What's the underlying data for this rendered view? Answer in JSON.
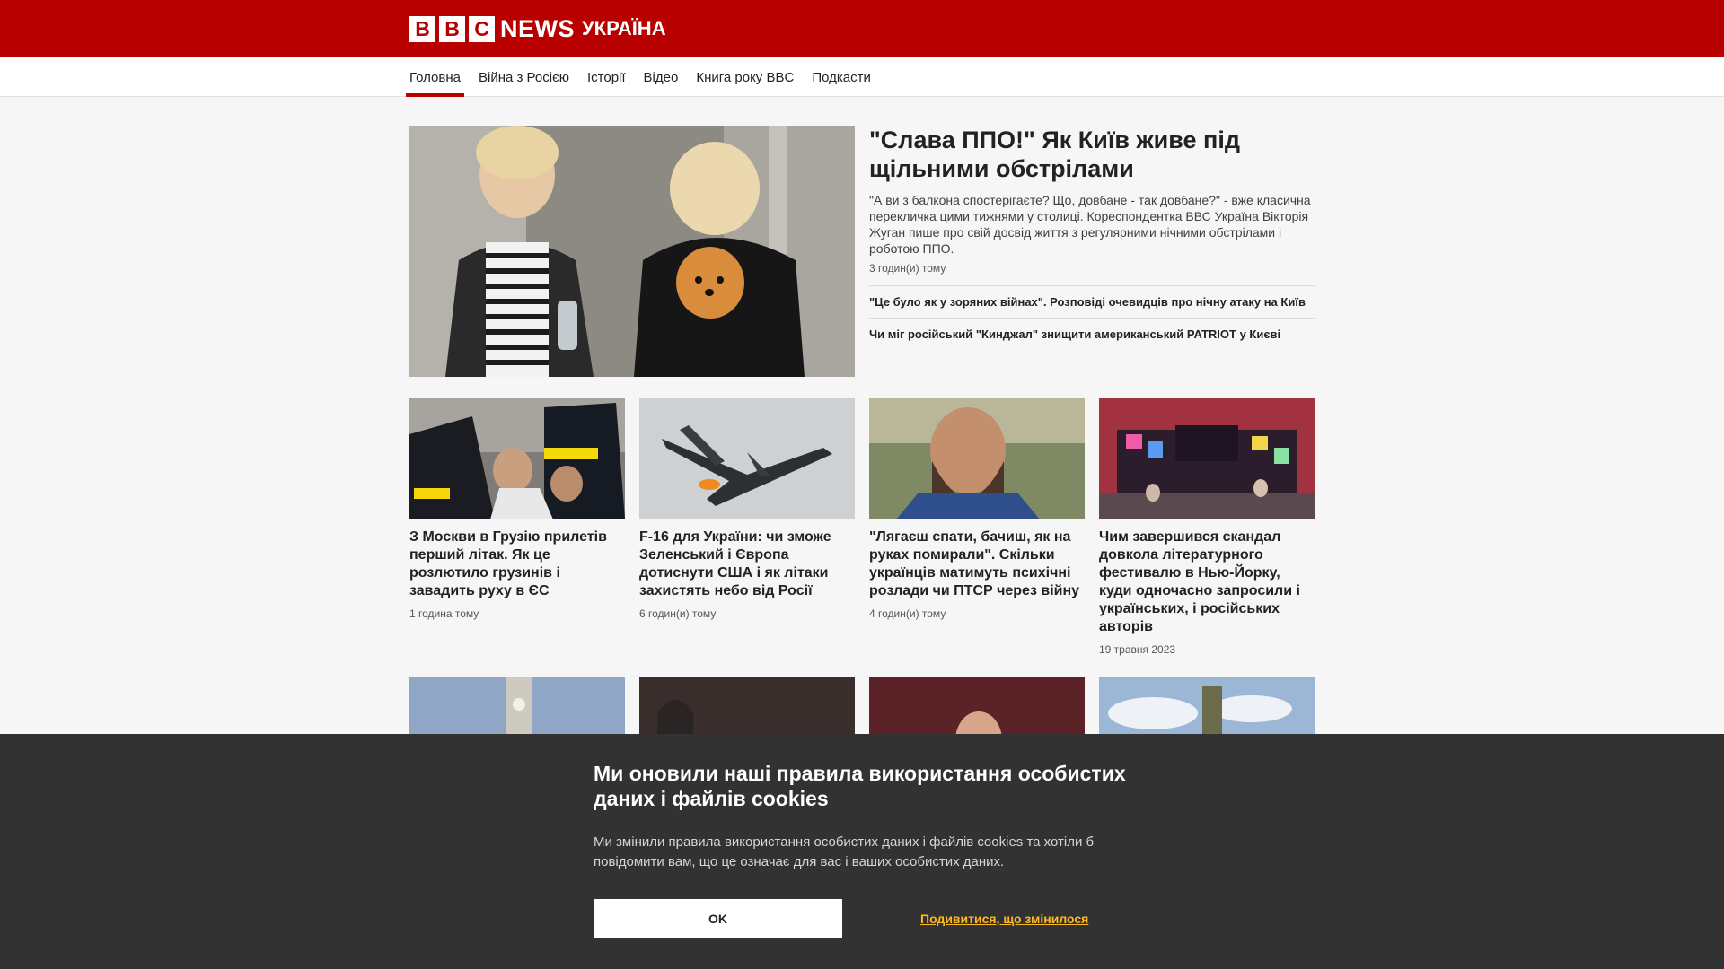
{
  "header": {
    "logo_letters": [
      "B",
      "B",
      "C"
    ],
    "logo_news": "NEWS",
    "logo_service": "УКРАЇНА",
    "brand_color": "#b80000"
  },
  "nav": {
    "items": [
      {
        "label": "Головна",
        "active": true
      },
      {
        "label": "Війна з Росією",
        "active": false
      },
      {
        "label": "Історії",
        "active": false
      },
      {
        "label": "Відео",
        "active": false
      },
      {
        "label": "Книга року BBC",
        "active": false
      },
      {
        "label": "Подкасти",
        "active": false
      }
    ]
  },
  "top_story": {
    "headline": "\"Слава ППО!\" Як Київ живе під щільними обстрілами",
    "summary": "\"А ви з балкона спостерігаєте? Що, довбане - так довбане?\" - вже класична перекличка цими тижнями у столиці. Кореспондентка ВВС Україна Вікторія Жуган пише про свій досвід життя з регулярними нічними обстрілами і роботою ППО.",
    "timestamp": "3 годин(и) тому",
    "related": [
      "\"Це було як у зоряних війнах\". Розповіді очевидців про нічну атаку на Київ",
      "Чи міг російський \"Кинджал\" знищити американський PATRIOT у Києві"
    ],
    "image_alt": "women-with-dog-photo"
  },
  "cards": [
    {
      "title": "З Москви в Грузію прилетів перший літак. Як це розлютило грузинів і завадить руху в ЄС",
      "timestamp": "1 година тому"
    },
    {
      "title": "F-16 для України: чи зможе Зеленський і Європа дотиснути США і як літаки захистять небо від Росії",
      "timestamp": "6 годин(и) тому"
    },
    {
      "title": "\"Лягаєш спати, бачиш, як на руках помирали\". Скільки українців матимуть психічні розлади чи ПТСР через війну",
      "timestamp": "4 годин(и) тому"
    },
    {
      "title": "Чим завершився скандал довкола літературного фестивалю в Нью-Йорку, куди одночасно запросили і українських, і російських авторів",
      "timestamp": "19 травня 2023"
    }
  ],
  "cookie_banner": {
    "title": "Ми оновили наші правила використання особистих даних і файлів cookies",
    "text": "Ми змінили правила використання особистих даних і файлів cookies та хотіли б повідомити вам, що це означає для вас і ваших особистих даних.",
    "ok_label": "OK",
    "change_label": "Подивитися, що змінилося",
    "link_color": "#fcb924"
  }
}
